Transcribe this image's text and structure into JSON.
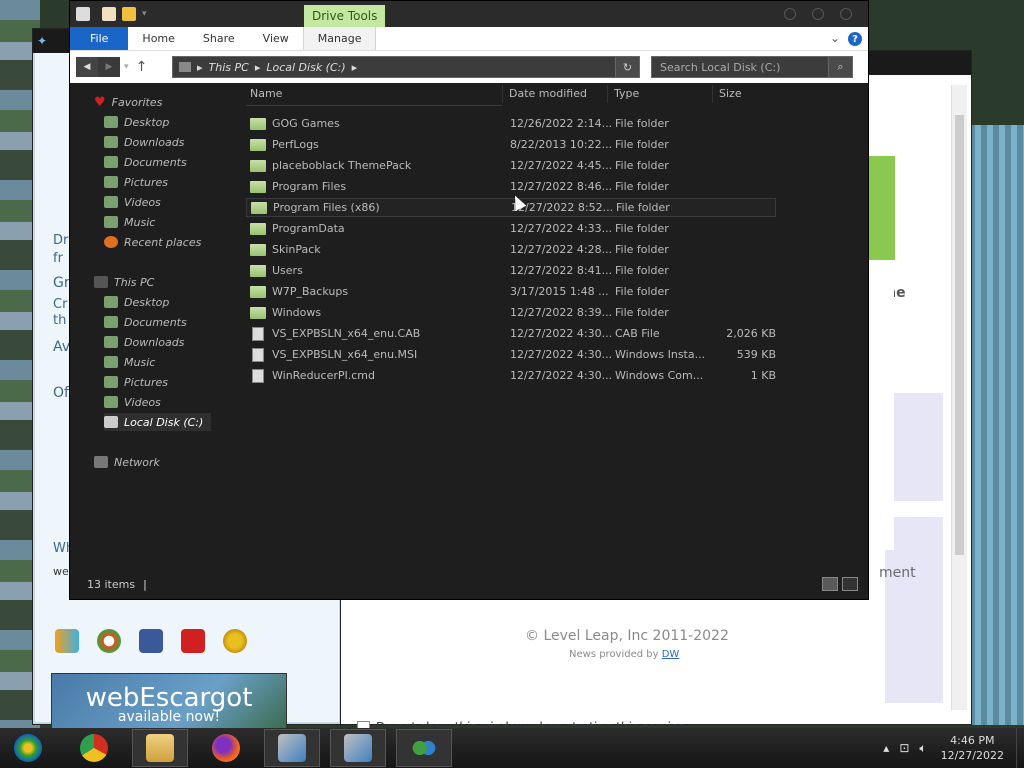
{
  "explorer": {
    "ribbon_context_tab": "Drive Tools",
    "tabs": [
      "File",
      "Home",
      "Share",
      "View",
      "Manage"
    ],
    "help_label": "?",
    "breadcrumb": [
      "This PC",
      "Local Disk (C:)"
    ],
    "search_placeholder": "Search Local Disk (C:)",
    "nav": {
      "favorites": {
        "label": "Favorites",
        "items": [
          "Desktop",
          "Downloads",
          "Documents",
          "Pictures",
          "Videos",
          "Music",
          "Recent places"
        ]
      },
      "this_pc": {
        "label": "This PC",
        "items": [
          "Desktop",
          "Documents",
          "Downloads",
          "Music",
          "Pictures",
          "Videos",
          "Local Disk (C:)"
        ]
      },
      "network": "Network"
    },
    "columns": {
      "name": "Name",
      "date": "Date modified",
      "type": "Type",
      "size": "Size"
    },
    "files": [
      {
        "name": "GOG Games",
        "date": "12/26/2022 2:14...",
        "type": "File folder",
        "size": "",
        "kind": "folder"
      },
      {
        "name": "PerfLogs",
        "date": "8/22/2013 10:22...",
        "type": "File folder",
        "size": "",
        "kind": "folder"
      },
      {
        "name": "placeboblack ThemePack",
        "date": "12/27/2022 4:45...",
        "type": "File folder",
        "size": "",
        "kind": "folder"
      },
      {
        "name": "Program Files",
        "date": "12/27/2022 8:46...",
        "type": "File folder",
        "size": "",
        "kind": "folder"
      },
      {
        "name": "Program Files (x86)",
        "date": "12/27/2022 8:52...",
        "type": "File folder",
        "size": "",
        "kind": "folder"
      },
      {
        "name": "ProgramData",
        "date": "12/27/2022 4:33...",
        "type": "File folder",
        "size": "",
        "kind": "folder"
      },
      {
        "name": "SkinPack",
        "date": "12/27/2022 4:28...",
        "type": "File folder",
        "size": "",
        "kind": "folder"
      },
      {
        "name": "Users",
        "date": "12/27/2022 8:41...",
        "type": "File folder",
        "size": "",
        "kind": "folder"
      },
      {
        "name": "W7P_Backups",
        "date": "3/17/2015 1:48 ...",
        "type": "File folder",
        "size": "",
        "kind": "folder"
      },
      {
        "name": "Windows",
        "date": "12/27/2022 8:39...",
        "type": "File folder",
        "size": "",
        "kind": "folder"
      },
      {
        "name": "VS_EXPBSLN_x64_enu.CAB",
        "date": "12/27/2022 4:30...",
        "type": "CAB File",
        "size": "2,026 KB",
        "kind": "file"
      },
      {
        "name": "VS_EXPBSLN_x64_enu.MSI",
        "date": "12/27/2022 4:30...",
        "type": "Windows Insta...",
        "size": "539 KB",
        "kind": "file"
      },
      {
        "name": "WinReducerPI.cmd",
        "date": "12/27/2022 4:30...",
        "type": "Windows Com...",
        "size": "1 KB",
        "kind": "file"
      }
    ],
    "status": "13 items"
  },
  "background_window": {
    "banner_title": "webEscargot",
    "banner_sub": "available now!",
    "side_fragments": [
      "Dr",
      "fr",
      "Gro",
      "Cr",
      "th",
      "Av",
      "Of",
      "Wh",
      "web"
    ]
  },
  "service_window": {
    "fragment_right_1": "o the",
    "fragment_right_2": "ment",
    "copyright": "© Level Leap, Inc 2011-2022",
    "news_prefix": "News provided by",
    "news_link": "DW",
    "dont_show": "Do not show this window when starting this service."
  },
  "taskbar": {
    "apps": [
      "start-orb",
      "chrome",
      "file-explorer",
      "firefox",
      "setup-1",
      "setup-2",
      "messenger"
    ],
    "time": "4:46 PM",
    "date": "12/27/2022"
  }
}
